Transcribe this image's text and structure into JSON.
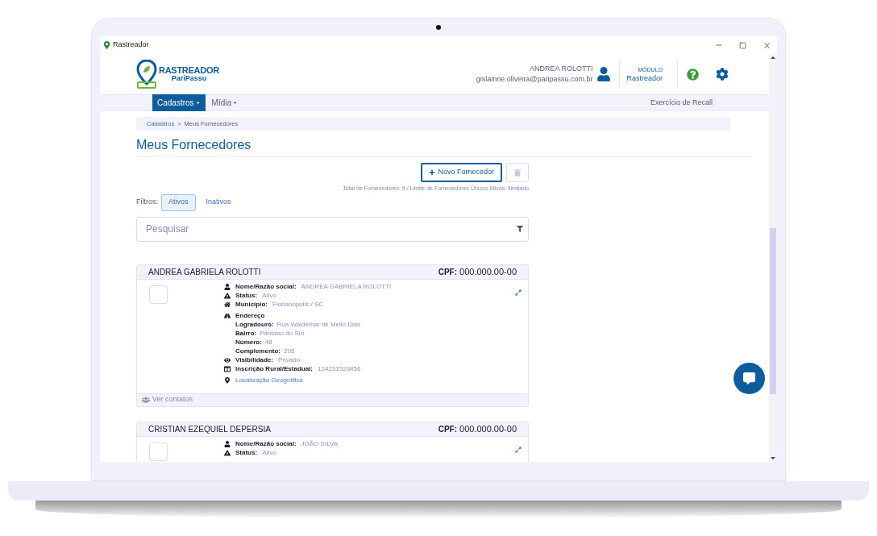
{
  "window": {
    "title": "Rastreador"
  },
  "header": {
    "logo_title": "RASTREADOR",
    "logo_subtitle": "PariPassu",
    "user_name": "ANDREA ROLOTTI",
    "user_email": "gislainne.oliveira@paripassu.com.br",
    "module_label": "MÓDULO",
    "module_name": "Rastreador"
  },
  "nav": {
    "items": [
      {
        "label": "Cadastros",
        "selected": true
      },
      {
        "label": "Mídia",
        "selected": false
      }
    ],
    "right_link": "Exercício de Recall"
  },
  "breadcrumb": [
    "Cadastros",
    "Meus Fornecedores"
  ],
  "breadcrumb_separator": ">",
  "page_title": "Meus Fornecedores",
  "new_button": "Novo Fornecedor",
  "totals": "Total de Fornecedores: 5 / Limite de Fornecedores Únicos Ativos: Ilimitado",
  "filters_label": "Filtros:",
  "filters": [
    {
      "label": "Ativos",
      "selected": true
    },
    {
      "label": "Inativos",
      "selected": false
    }
  ],
  "search": {
    "placeholder": "Pesquisar"
  },
  "cards": [
    {
      "name": "ANDREA GABRIELA ROLOTTI",
      "cpf_label": "CPF:",
      "cpf": "000.000.00-00",
      "footer": "Ver contatos",
      "fields": [
        {
          "kind": "field",
          "label": "Nome/Razão social:",
          "value": "ANDREA GABRIELA ROLOTTI"
        },
        {
          "kind": "field",
          "label": "Status:",
          "value": "Ativo"
        },
        {
          "kind": "field",
          "label": "Município:",
          "value": "Florianópolis / SC"
        },
        {
          "kind": "heading",
          "label": "Endereço"
        },
        {
          "kind": "subfield",
          "label": "Logradouro:",
          "value": "Rua Waldemar de Mello Dias"
        },
        {
          "kind": "subfield",
          "label": "Bairro:",
          "value": "Pântano do Sul"
        },
        {
          "kind": "subfield",
          "label": "Número:",
          "value": "48"
        },
        {
          "kind": "subfield",
          "label": "Complemento:",
          "value": "205"
        },
        {
          "kind": "field",
          "label": "Visibilidade:",
          "value": "Privado"
        },
        {
          "kind": "field",
          "label": "Inscrição Rural/Estadual:",
          "value": "124231523456"
        },
        {
          "kind": "link",
          "label": "Localização Geográfica"
        }
      ]
    },
    {
      "name": "CRISTIAN EZEQUIEL DEPERSIA",
      "cpf_label": "CPF:",
      "cpf": "000.000.00-00",
      "fields": [
        {
          "kind": "field",
          "label": "Nome/Razão social:",
          "value": "JOÃO SILVA"
        },
        {
          "kind": "field",
          "label": "Status:",
          "value": "Ativo"
        }
      ]
    }
  ]
}
